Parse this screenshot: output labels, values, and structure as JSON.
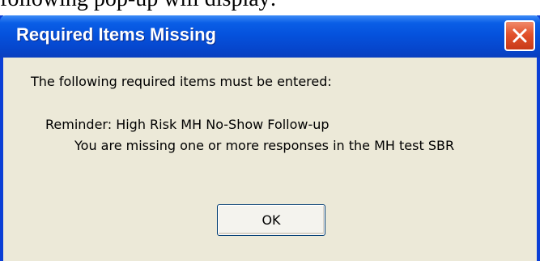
{
  "background_text": "following pop-up will display:",
  "dialog": {
    "title": "Required Items Missing",
    "close_icon": "close-icon",
    "message_intro": "The following required items must be entered:",
    "reminder": "Reminder: High Risk MH No-Show Follow-up",
    "detail": "You are missing one or more responses in the MH test SBR",
    "ok_label": "OK"
  },
  "colors": {
    "titlebar": "#0552dd",
    "window_border": "#0a3fd6",
    "dialog_background": "#ece9d8",
    "close_button": "#e2522c"
  }
}
